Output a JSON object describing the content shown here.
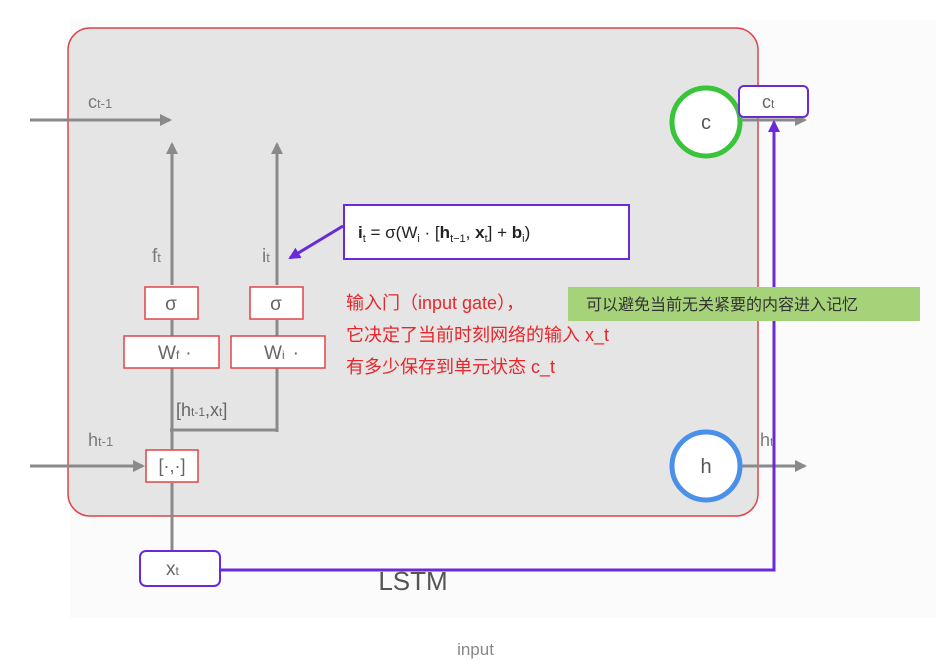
{
  "diagram": {
    "cell_label": "LSTM",
    "inputs": {
      "c_prev": "c",
      "c_prev_sub": "t-1",
      "h_prev": "h",
      "h_prev_sub": "t-1",
      "x": "x",
      "x_sub": "t"
    },
    "outputs": {
      "c": "c",
      "c_sub": "t",
      "h": "h",
      "h_sub": "t"
    },
    "gates": {
      "forget_label": "f",
      "forget_sub": "t",
      "input_label": "i",
      "input_sub": "t",
      "sigma": "σ",
      "wf": "W",
      "wf_sub": "f",
      "wf_dot": "·",
      "wi": "W",
      "wi_sub": "i",
      "wi_dot": "·"
    },
    "concat": {
      "box": "[·,·]",
      "label_open": "[h",
      "label_sub1": "t-1",
      "label_mid": ",x",
      "label_sub2": "t",
      "label_close": "]"
    },
    "states": {
      "cell": "c",
      "hidden": "h"
    },
    "formula": {
      "bold_i": "i",
      "i_sub": "t",
      "eq": " = σ(W",
      "w_sub": "i",
      "mid": " · [",
      "bold_h": "h",
      "h_sub": "t−1",
      "comma": ", ",
      "bold_x": "x",
      "x_sub": "t",
      "close": "] + ",
      "bold_b": "b",
      "b_sub": "i",
      "end": ")"
    },
    "annotation": {
      "line1": "输入门（input gate），",
      "line2": "它决定了当前时刻网络的输入 x_t",
      "line3": "有多少保存到单元状态 c_t"
    },
    "note": "可以避免当前无关紧要的内容进入记忆",
    "colors": {
      "cell_fill": "#e5e5e5",
      "cell_border": "#e0454a",
      "arrow": "#8a8a8a",
      "purple": "#6a2ad8",
      "red_text": "#e8262b",
      "green": "#3ac43a",
      "blue": "#4a90e8",
      "note_bg": "#a6d27a"
    }
  },
  "caption": "input"
}
